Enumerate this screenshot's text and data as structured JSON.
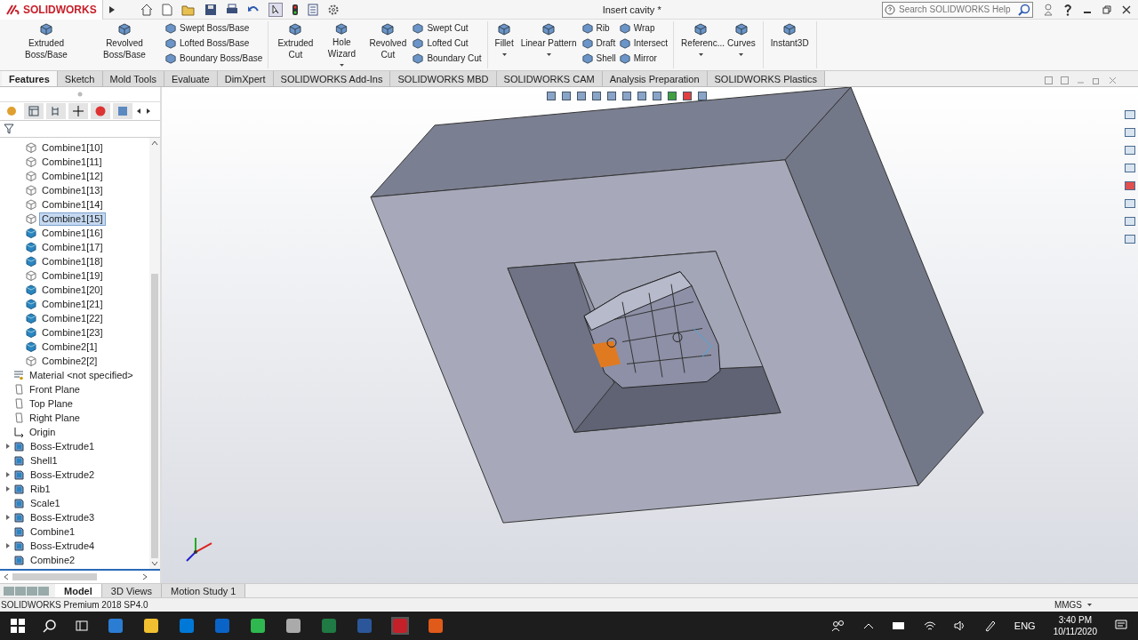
{
  "app": {
    "logo": "SOLIDWORKS",
    "title": "Insert cavity *",
    "search": {
      "placeholder": "Search SOLIDWORKS Help"
    }
  },
  "ribbon": [
    {
      "big": [
        {
          "label": "Extruded Boss/Base",
          "dropdown": false
        },
        {
          "label": "Revolved Boss/Base",
          "dropdown": false
        }
      ],
      "columns": [
        [
          "Swept Boss/Base",
          "Lofted Boss/Base",
          "Boundary Boss/Base"
        ]
      ]
    },
    {
      "big": [
        {
          "label": "Extruded Cut",
          "dropdown": false
        },
        {
          "label": "Hole Wizard",
          "dropdown": true
        },
        {
          "label": "Revolved Cut",
          "dropdown": false
        }
      ],
      "columns": [
        [
          "Swept Cut",
          "Lofted Cut",
          "Boundary Cut"
        ]
      ]
    },
    {
      "big": [
        {
          "label": "Fillet",
          "dropdown": true
        },
        {
          "label": "Linear Pattern",
          "dropdown": true
        }
      ],
      "columns": [
        [
          "Rib",
          "Draft",
          "Shell"
        ],
        [
          "Wrap",
          "Intersect",
          "Mirror"
        ]
      ]
    },
    {
      "big": [
        {
          "label": "Referenc...",
          "dropdown": true
        },
        {
          "label": "Curves",
          "dropdown": true
        }
      ]
    },
    {
      "big": [
        {
          "label": "Instant3D",
          "dropdown": false
        }
      ]
    }
  ],
  "tabs": [
    {
      "label": "Features",
      "selected": true
    },
    {
      "label": "Sketch",
      "selected": false
    },
    {
      "label": "Mold Tools",
      "selected": false
    },
    {
      "label": "Evaluate",
      "selected": false
    },
    {
      "label": "DimXpert",
      "selected": false
    },
    {
      "label": "SOLIDWORKS Add-Ins",
      "selected": false
    },
    {
      "label": "SOLIDWORKS MBD",
      "selected": false
    },
    {
      "label": "SOLIDWORKS CAM",
      "selected": false
    },
    {
      "label": "Analysis Preparation",
      "selected": false
    },
    {
      "label": "SOLIDWORKS Plastics",
      "selected": false
    }
  ],
  "panel_tabs": [
    {
      "selected": true
    },
    {
      "selected": false
    },
    {
      "selected": false
    },
    {
      "selected": false
    },
    {
      "selected": false
    },
    {
      "selected": false
    }
  ],
  "tree": [
    {
      "label": "Combine1[10]",
      "kind": "hollow-body",
      "selected": false,
      "expandable": false
    },
    {
      "label": "Combine1[11]",
      "kind": "hollow-body",
      "selected": false,
      "expandable": false
    },
    {
      "label": "Combine1[12]",
      "kind": "hollow-body",
      "selected": false,
      "expandable": false
    },
    {
      "label": "Combine1[13]",
      "kind": "hollow-body",
      "selected": false,
      "expandable": false
    },
    {
      "label": "Combine1[14]",
      "kind": "hollow-body",
      "selected": false,
      "expandable": false
    },
    {
      "label": "Combine1[15]",
      "kind": "hollow-body",
      "selected": true,
      "expandable": false
    },
    {
      "label": "Combine1[16]",
      "kind": "solid-body",
      "selected": false,
      "expandable": false
    },
    {
      "label": "Combine1[17]",
      "kind": "solid-body",
      "selected": false,
      "expandable": false
    },
    {
      "label": "Combine1[18]",
      "kind": "solid-body",
      "selected": false,
      "expandable": false
    },
    {
      "label": "Combine1[19]",
      "kind": "hollow-body",
      "selected": false,
      "expandable": false
    },
    {
      "label": "Combine1[20]",
      "kind": "solid-body",
      "selected": false,
      "expandable": false
    },
    {
      "label": "Combine1[21]",
      "kind": "solid-body",
      "selected": false,
      "expandable": false
    },
    {
      "label": "Combine1[22]",
      "kind": "solid-body",
      "selected": false,
      "expandable": false
    },
    {
      "label": "Combine1[23]",
      "kind": "solid-body",
      "selected": false,
      "expandable": false
    },
    {
      "label": "Combine2[1]",
      "kind": "solid-body",
      "selected": false,
      "expandable": false
    },
    {
      "label": "Combine2[2]",
      "kind": "hollow-body",
      "selected": false,
      "expandable": false
    },
    {
      "label": "Material <not specified>",
      "kind": "material",
      "selected": false,
      "expandable": false
    },
    {
      "label": "Front Plane",
      "kind": "plane",
      "selected": false,
      "expandable": false
    },
    {
      "label": "Top Plane",
      "kind": "plane",
      "selected": false,
      "expandable": false
    },
    {
      "label": "Right Plane",
      "kind": "plane",
      "selected": false,
      "expandable": false
    },
    {
      "label": "Origin",
      "kind": "origin",
      "selected": false,
      "expandable": false
    },
    {
      "label": "Boss-Extrude1",
      "kind": "feature",
      "selected": false,
      "expandable": true
    },
    {
      "label": "Shell1",
      "kind": "feature",
      "selected": false,
      "expandable": false
    },
    {
      "label": "Boss-Extrude2",
      "kind": "feature",
      "selected": false,
      "expandable": true
    },
    {
      "label": "Rib1",
      "kind": "feature",
      "selected": false,
      "expandable": true
    },
    {
      "label": "Scale1",
      "kind": "feature",
      "selected": false,
      "expandable": false
    },
    {
      "label": "Boss-Extrude3",
      "kind": "feature",
      "selected": false,
      "expandable": true
    },
    {
      "label": "Combine1",
      "kind": "feature",
      "selected": false,
      "expandable": false
    },
    {
      "label": "Boss-Extrude4",
      "kind": "feature",
      "selected": false,
      "expandable": true
    },
    {
      "label": "Combine2",
      "kind": "feature",
      "selected": false,
      "expandable": false
    }
  ],
  "bottom_tabs": [
    {
      "label": "Model",
      "selected": true
    },
    {
      "label": "3D Views",
      "selected": false
    },
    {
      "label": "Motion Study 1",
      "selected": false
    }
  ],
  "status_bar": {
    "product": "SOLIDWORKS Premium 2018 SP4.0",
    "units": "MMGS"
  },
  "taskbar": {
    "language": "ENG",
    "time": "3:40 PM",
    "date": "10/11/2020"
  }
}
